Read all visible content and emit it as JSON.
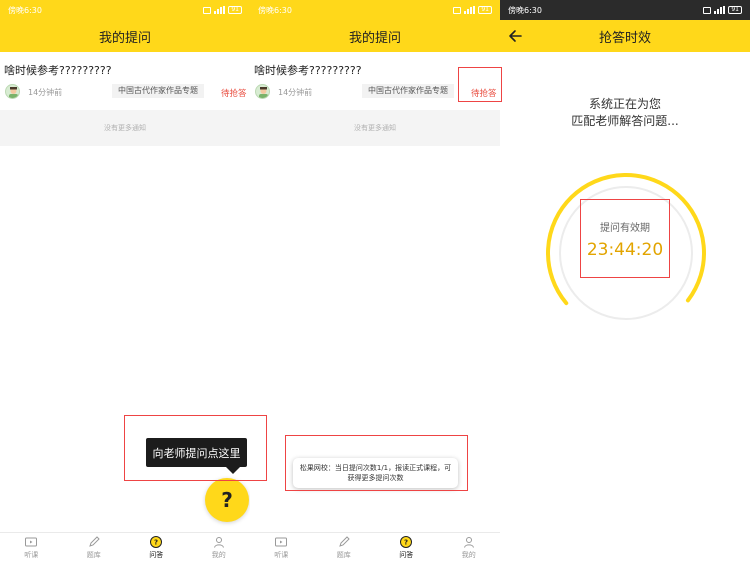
{
  "status_bar": {
    "time": "傍晚6:30",
    "battery": "91"
  },
  "screens": [
    {
      "header_title": "我的提问",
      "question": {
        "title": "啥时候参考?????????",
        "time_ago": "14分钟前",
        "tag": "中国古代作家作品专题",
        "status": "待抢答"
      },
      "no_more_text": "没有更多通知",
      "tooltip": "向老师提问点这里",
      "fab_label": "?"
    },
    {
      "header_title": "我的提问",
      "question": {
        "title": "啥时候参考?????????",
        "time_ago": "14分钟前",
        "tag": "中国古代作家作品专题",
        "status": "待抢答"
      },
      "no_more_text": "没有更多通知",
      "toast": "松果网校：当日提问次数1/1，报读正式课程，可获得更多提问次数",
      "fab_label": "?"
    },
    {
      "header_title": "抢答时效",
      "matching_text_line1": "系统正在为您",
      "matching_text_line2": "匹配老师解答问题...",
      "validity_label": "提问有效期",
      "countdown": "23:44:20",
      "countdown_fraction_remaining": 0.99
    }
  ],
  "tabbar": {
    "items": [
      {
        "label": "听课",
        "icon": "tv-icon"
      },
      {
        "label": "题库",
        "icon": "pencil-icon"
      },
      {
        "label": "问答",
        "icon": "question-icon"
      },
      {
        "label": "我的",
        "icon": "user-icon"
      }
    ],
    "active_index": 2
  },
  "colors": {
    "accent": "#ffd81a",
    "status_red": "#e84a3c",
    "countdown": "#e2a400",
    "annotation": "#ee4444"
  }
}
